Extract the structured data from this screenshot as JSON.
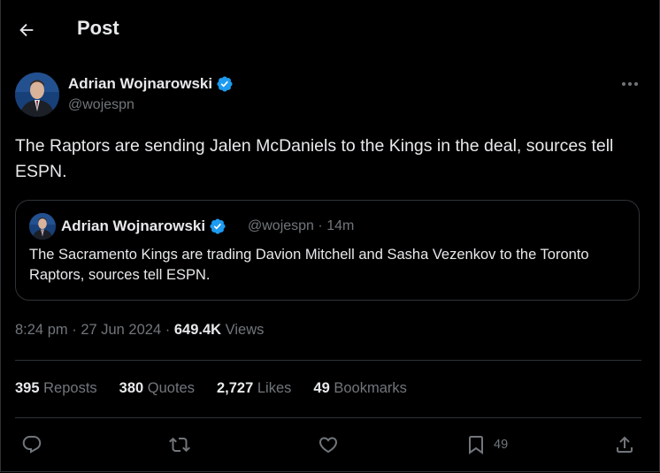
{
  "header": {
    "title": "Post"
  },
  "tweet": {
    "author_name": "Adrian Wojnarowski",
    "author_handle": "@wojespn",
    "text": "The Raptors are sending Jalen McDaniels to the Kings in the deal, sources tell ESPN.",
    "time": "8:24 pm",
    "date": "27 Jun 2024",
    "views_count": "649.4K",
    "views_label": "Views"
  },
  "quoted": {
    "author_name": "Adrian Wojnarowski",
    "author_handle": "@wojespn",
    "age": "14m",
    "text": "The Sacramento Kings are trading Davion Mitchell and Sasha Vezenkov to the Toronto Raptors, sources tell ESPN."
  },
  "stats": {
    "reposts_count": "395",
    "reposts_label": "Reposts",
    "quotes_count": "380",
    "quotes_label": "Quotes",
    "likes_count": "2,727",
    "likes_label": "Likes",
    "bookmarks_count": "49",
    "bookmarks_label": "Bookmarks"
  },
  "actions": {
    "bookmark_count": "49"
  },
  "colors": {
    "background": "#000000",
    "text": "#e7e9ea",
    "muted": "#71767b",
    "border": "#2f3336",
    "verified": "#1d9bf0"
  },
  "icons": {
    "back": "arrow-left-icon",
    "verified": "verified-badge-icon",
    "more": "more-dots-icon",
    "reply": "reply-icon",
    "repost": "repost-icon",
    "like": "heart-icon",
    "bookmark": "bookmark-icon",
    "share": "share-icon"
  }
}
